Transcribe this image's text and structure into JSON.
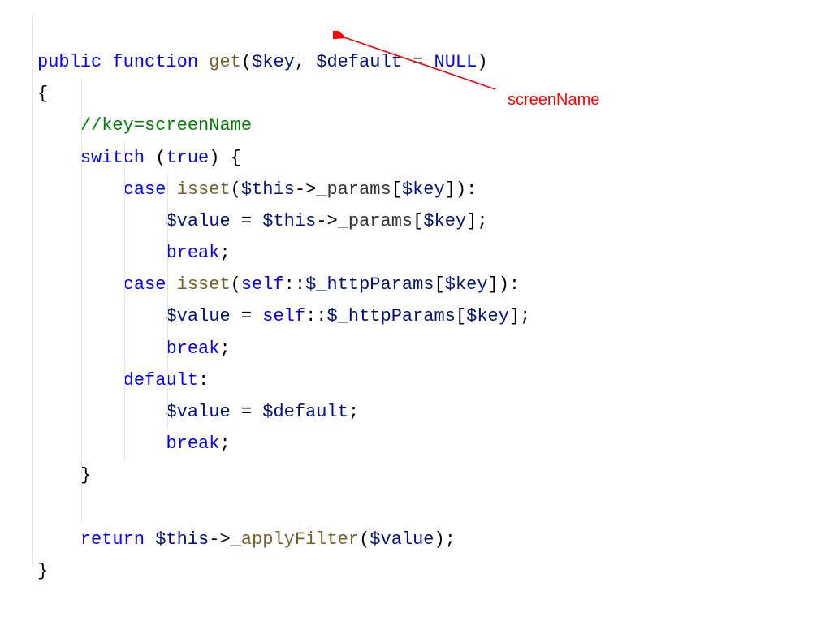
{
  "code": {
    "l1_public": "public",
    "l1_function": "function",
    "l1_get": "get",
    "l1_p1": "(",
    "l1_key": "$key",
    "l1_comma": ", ",
    "l1_default": "$default",
    "l1_eq": " = ",
    "l1_null": "NULL",
    "l1_p2": ")",
    "l2_brace": "{",
    "l3_comment": "//key=screenName",
    "l4_switch": "switch",
    "l4_p1": " (",
    "l4_true": "true",
    "l4_p2": ") {",
    "l5_case": "case",
    "l5_isset": "isset",
    "l5_p1": "(",
    "l5_this": "$this",
    "l5_arrow": "->",
    "l5_params": "_params",
    "l5_b1": "[",
    "l5_key": "$key",
    "l5_b2": "]):",
    "l6_value": "$value",
    "l6_eq": " = ",
    "l6_this": "$this",
    "l6_arrow": "->",
    "l6_params": "_params",
    "l6_b1": "[",
    "l6_key": "$key",
    "l6_b2": "];",
    "l7_break": "break",
    "l7_semi": ";",
    "l8_case": "case",
    "l8_isset": "isset",
    "l8_p1": "(",
    "l8_self": "self",
    "l8_scope": "::",
    "l8_http": "$_httpParams",
    "l8_b1": "[",
    "l8_key": "$key",
    "l8_b2": "]):",
    "l9_value": "$value",
    "l9_eq": " = ",
    "l9_self": "self",
    "l9_scope": "::",
    "l9_http": "$_httpParams",
    "l9_b1": "[",
    "l9_key": "$key",
    "l9_b2": "];",
    "l10_break": "break",
    "l10_semi": ";",
    "l11_default": "default",
    "l11_colon": ":",
    "l12_value": "$value",
    "l12_eq": " = ",
    "l12_default": "$default",
    "l12_semi": ";",
    "l13_break": "break",
    "l13_semi": ";",
    "l14_brace": "}",
    "l16_return": "return",
    "l16_this": " $this",
    "l16_arrow": "->",
    "l16_apply": "_applyFilter",
    "l16_p1": "(",
    "l16_value": "$value",
    "l16_p2": ");",
    "l17_brace": "}"
  },
  "annotation": {
    "label": "screenName"
  }
}
